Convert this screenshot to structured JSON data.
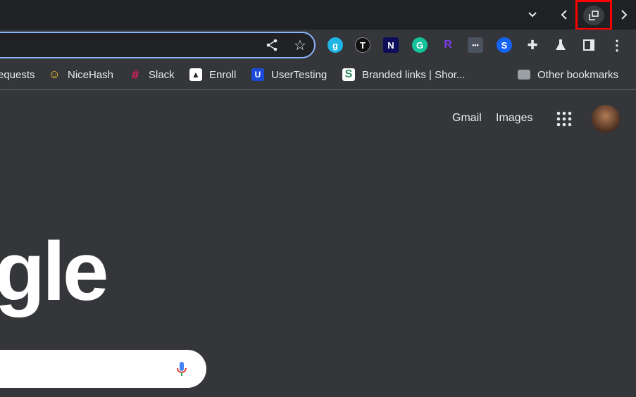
{
  "tabstrip": {
    "tab_search": "chevron-down",
    "back": "‹",
    "forward": "›"
  },
  "toolbar": {
    "extensions": [
      "g",
      "T",
      "N",
      "G",
      "R",
      "•••",
      "S"
    ]
  },
  "bookmarks": [
    {
      "label": "equests",
      "icon": "",
      "color": "#35363a"
    },
    {
      "label": "NiceHash",
      "icon": "☺",
      "color": "#f4c430"
    },
    {
      "label": "Slack",
      "icon": "#",
      "color": "#e01e5a"
    },
    {
      "label": "Enroll",
      "icon": "▲",
      "color": "#ffffff"
    },
    {
      "label": "UserTesting",
      "icon": "U",
      "color": "#1a4bd8"
    },
    {
      "label": "Branded links | Shor...",
      "icon": "S",
      "color": "#2d8a5f"
    },
    {
      "label": "Other bookmarks",
      "icon": "",
      "color": "#9aa0a6"
    }
  ],
  "page": {
    "gmail": "Gmail",
    "images": "Images",
    "logo": "gle"
  },
  "colors": {
    "highlight": "#ff0000",
    "focus": "#8ab4f8"
  }
}
